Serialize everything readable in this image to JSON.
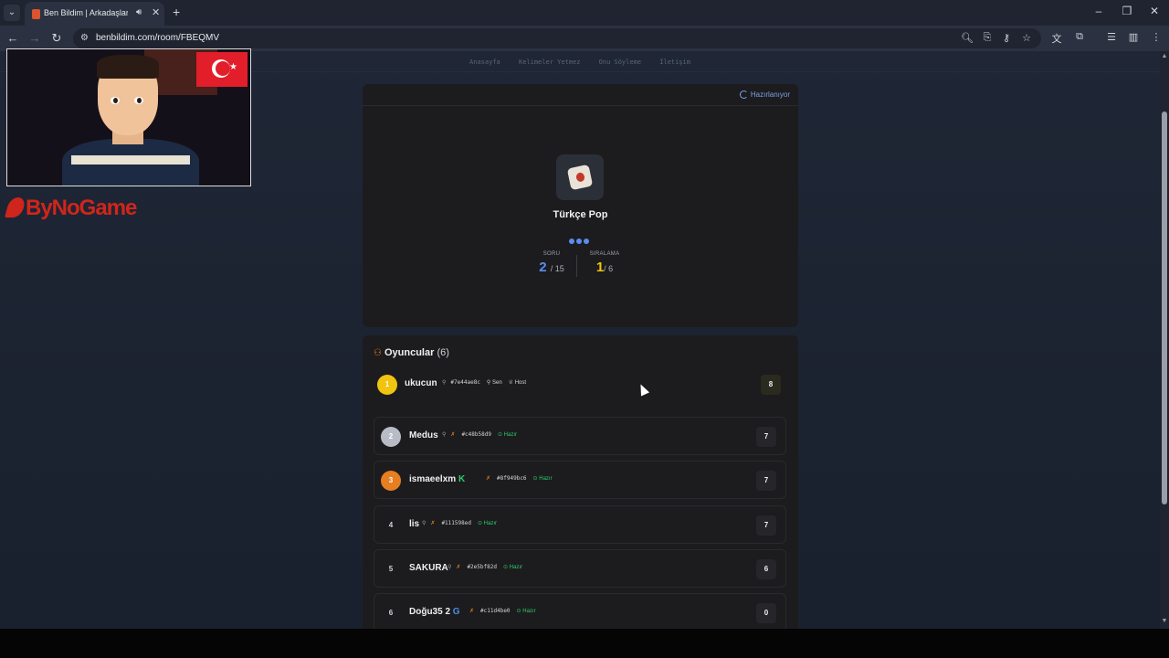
{
  "browser": {
    "tab_title": "Ben Bildim | Arkadaşlarınla ...",
    "url": "benbildim.com/room/FBEQMV"
  },
  "site_nav": {
    "items": [
      "Anasayfa",
      "Kelimeler Yetmez",
      "Onu Söyleme",
      "İletişim"
    ]
  },
  "game": {
    "status": "Hazırlanıyor",
    "category": "Türkçe Pop",
    "question_label": "SORU",
    "question_current": "2",
    "question_total": "/ 15",
    "rank_label": "SIRALAMA",
    "rank_current": "1",
    "rank_total": "/ 6"
  },
  "players": {
    "title": "Oyuncular",
    "count": "(6)",
    "list": [
      {
        "rank": "1",
        "name": "ukucun",
        "id": "#7e44ae8c",
        "badge1": "Sen",
        "badge2": "Host",
        "score": "8"
      },
      {
        "rank": "2",
        "name": "Medus",
        "id": "#c48b58d9",
        "status": "Hazır",
        "score": "7"
      },
      {
        "rank": "3",
        "name": "ismaeelxm",
        "name_badge": "K",
        "id": "#8f949bc6",
        "status": "Hazır",
        "score": "7"
      },
      {
        "rank": "4",
        "name": "lis",
        "id": "#111598ed",
        "status": "Hazır",
        "score": "7"
      },
      {
        "rank": "5",
        "name": "SAKURA",
        "id": "#2e5bf82d",
        "status": "Hazır",
        "score": "6"
      },
      {
        "rank": "6",
        "name": "Doğu35 2",
        "name_badge": "G",
        "id": "#c11d4be0",
        "status": "Hazır",
        "score": "0"
      }
    ]
  },
  "overlay": {
    "brand": "ByNoGame"
  },
  "colors": {
    "accent_blue": "#5b8def",
    "gold": "#f1c40f",
    "ready_green": "#2ecc71",
    "card_bg": "#1c1c1e",
    "brand_red": "#d0251c"
  }
}
